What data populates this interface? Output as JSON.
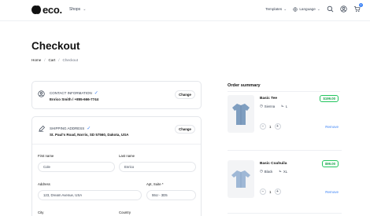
{
  "header": {
    "logo_text": "eco.",
    "nav_shops": "Shops",
    "templates": "Templates",
    "language": "Language",
    "cart_count": "2"
  },
  "page": {
    "title": "Checkout",
    "breadcrumb": [
      "Home",
      "Cart",
      "Checkout"
    ]
  },
  "contact": {
    "title": "CONTACT INFORMATION",
    "value": "Enrico Smith / +855-666-7744",
    "change_label": "Change"
  },
  "shipping": {
    "title": "SHIPPING ADDRESS",
    "value": "St. Paul's Road, Norris, SD 57560, Dakota, USA",
    "change_label": "Change",
    "fields": {
      "first_name_label": "First name",
      "first_name_value": "Cole",
      "last_name_label": "Last name",
      "last_name_value": "Enrico",
      "address_label": "Address",
      "address_value": "123, Dream Avenue, USA",
      "apt_label": "Apt, Suite *",
      "apt_value": "55U - 3D5",
      "city_label": "City",
      "country_label": "Country"
    }
  },
  "summary": {
    "title": "Order summary",
    "items": [
      {
        "name": "Basic Tee",
        "color": "Sienna",
        "size": "L",
        "qty": "1",
        "price": "$199.00",
        "remove": "Remove"
      },
      {
        "name": "Basic Coahuila",
        "color": "Black",
        "size": "XL",
        "qty": "1",
        "price": "$99.00",
        "remove": "Remove"
      }
    ]
  },
  "colors": {
    "accent": "#3b82f6",
    "price_green": "#16a34a",
    "thumb_shirt": "#7f9ec0"
  }
}
